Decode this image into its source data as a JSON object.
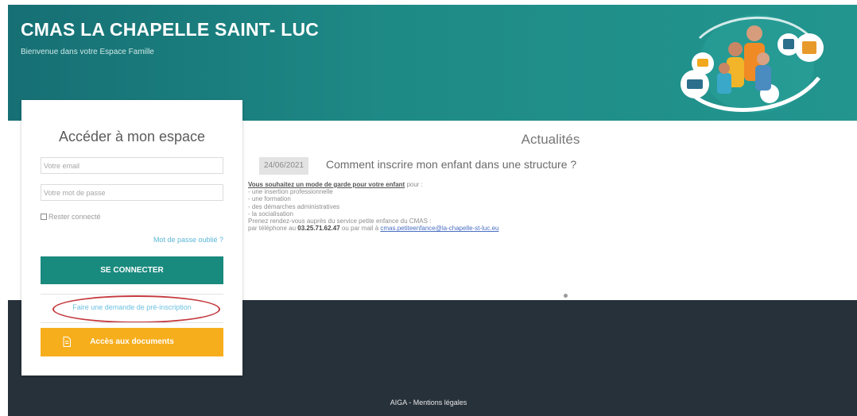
{
  "header": {
    "title": "CMAS LA CHAPELLE SAINT- LUC",
    "subtitle": "Bienvenue dans votre Espace Famille"
  },
  "login": {
    "title": "Accéder à mon espace",
    "email_placeholder": "Votre email",
    "password_placeholder": "Votre mot de passe",
    "remember_label": "Rester connecté",
    "forgot_link": "Mot de passe oublié ?",
    "submit_label": "SE CONNECTER",
    "preinscription_link": "Faire une demande de pré-inscription",
    "documents_label": "Accès aux documents"
  },
  "news": {
    "section_title": "Actualités",
    "date": "24/06/2021",
    "headline": "Comment inscrire mon enfant dans une structure ?",
    "intro_bold": "Vous souhaitez un mode de garde pour votre enfant",
    "intro_rest": " pour :",
    "items": [
      "- une insertion professionnelle",
      "- une formation",
      "- des démarches administratives",
      "- la socialisation"
    ],
    "contact_line": "Prenez rendez-vous auprès du service petite enfance du CMAS :",
    "phone_prefix": "par téléphone au ",
    "phone": "03.25.71.62.47",
    "mail_prefix": " ou par mail à ",
    "email": "cmas.petiteenfance@la-chapelle-st-luc.eu"
  },
  "footer": {
    "text": "AIGA  -  Mentions légales"
  },
  "icons": {
    "documents": "document-icon",
    "illustration": "family-illustration"
  },
  "colors": {
    "header_teal": "#1e8a86",
    "login_button": "#198a7e",
    "documents_button": "#f7ae1c",
    "annotation_red": "#c43a3f",
    "dark_background": "#27313a"
  }
}
